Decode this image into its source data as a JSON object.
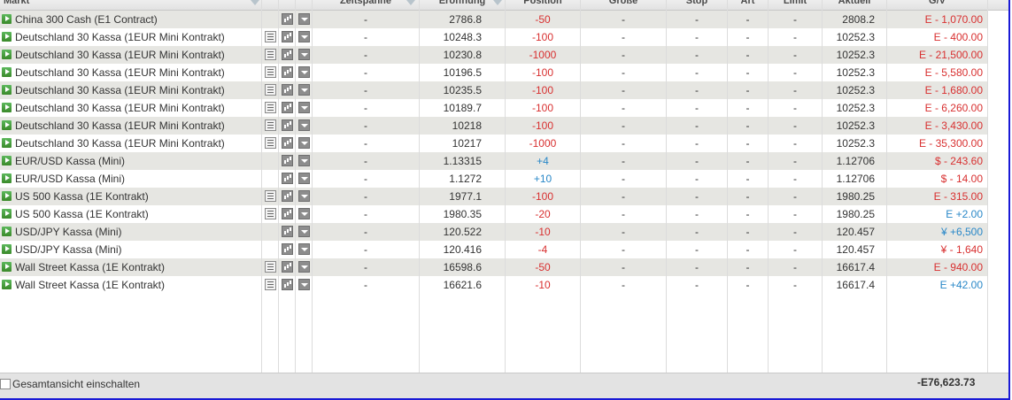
{
  "header": {
    "markt": "Markt",
    "zeitspanne": "Zeitspanne",
    "eroeffnung": "Eröffnung",
    "position": "Position",
    "groesse": "Größe",
    "stop": "Stop",
    "art": "Art",
    "limit": "Limit",
    "aktuell": "Aktuell",
    "gv": "G/V"
  },
  "rows": [
    {
      "name": "China 300 Cash (E1 Contract)",
      "notes": false,
      "zeit": "-",
      "open": "2786.8",
      "pos": "-50",
      "size": "-",
      "stop": "-",
      "art": "-",
      "limit": "-",
      "current": "2808.2",
      "pl": "E - 1,070.00",
      "pl_sign": "neg"
    },
    {
      "name": "Deutschland 30 Kassa (1EUR Mini Kontrakt)",
      "notes": true,
      "zeit": "-",
      "open": "10248.3",
      "pos": "-100",
      "size": "-",
      "stop": "-",
      "art": "-",
      "limit": "-",
      "current": "10252.3",
      "pl": "E - 400.00",
      "pl_sign": "neg"
    },
    {
      "name": "Deutschland 30 Kassa (1EUR Mini Kontrakt)",
      "notes": true,
      "zeit": "-",
      "open": "10230.8",
      "pos": "-1000",
      "size": "-",
      "stop": "-",
      "art": "-",
      "limit": "-",
      "current": "10252.3",
      "pl": "E - 21,500.00",
      "pl_sign": "neg"
    },
    {
      "name": "Deutschland 30 Kassa (1EUR Mini Kontrakt)",
      "notes": true,
      "zeit": "-",
      "open": "10196.5",
      "pos": "-100",
      "size": "-",
      "stop": "-",
      "art": "-",
      "limit": "-",
      "current": "10252.3",
      "pl": "E - 5,580.00",
      "pl_sign": "neg"
    },
    {
      "name": "Deutschland 30 Kassa (1EUR Mini Kontrakt)",
      "notes": true,
      "zeit": "-",
      "open": "10235.5",
      "pos": "-100",
      "size": "-",
      "stop": "-",
      "art": "-",
      "limit": "-",
      "current": "10252.3",
      "pl": "E - 1,680.00",
      "pl_sign": "neg"
    },
    {
      "name": "Deutschland 30 Kassa (1EUR Mini Kontrakt)",
      "notes": true,
      "zeit": "-",
      "open": "10189.7",
      "pos": "-100",
      "size": "-",
      "stop": "-",
      "art": "-",
      "limit": "-",
      "current": "10252.3",
      "pl": "E - 6,260.00",
      "pl_sign": "neg"
    },
    {
      "name": "Deutschland 30 Kassa (1EUR Mini Kontrakt)",
      "notes": true,
      "zeit": "-",
      "open": "10218",
      "pos": "-100",
      "size": "-",
      "stop": "-",
      "art": "-",
      "limit": "-",
      "current": "10252.3",
      "pl": "E - 3,430.00",
      "pl_sign": "neg"
    },
    {
      "name": "Deutschland 30 Kassa (1EUR Mini Kontrakt)",
      "notes": true,
      "zeit": "-",
      "open": "10217",
      "pos": "-1000",
      "size": "-",
      "stop": "-",
      "art": "-",
      "limit": "-",
      "current": "10252.3",
      "pl": "E - 35,300.00",
      "pl_sign": "neg"
    },
    {
      "name": "EUR/USD Kassa (Mini)",
      "notes": false,
      "zeit": "-",
      "open": "1.13315",
      "pos": "+4",
      "size": "-",
      "stop": "-",
      "art": "-",
      "limit": "-",
      "current": "1.12706",
      "pl": "$ - 243.60",
      "pl_sign": "neg"
    },
    {
      "name": "EUR/USD Kassa (Mini)",
      "notes": false,
      "zeit": "-",
      "open": "1.1272",
      "pos": "+10",
      "size": "-",
      "stop": "-",
      "art": "-",
      "limit": "-",
      "current": "1.12706",
      "pl": "$ - 14.00",
      "pl_sign": "neg"
    },
    {
      "name": "US 500 Kassa (1E Kontrakt)",
      "notes": true,
      "zeit": "-",
      "open": "1977.1",
      "pos": "-100",
      "size": "-",
      "stop": "-",
      "art": "-",
      "limit": "-",
      "current": "1980.25",
      "pl": "E - 315.00",
      "pl_sign": "neg"
    },
    {
      "name": "US 500 Kassa (1E Kontrakt)",
      "notes": true,
      "zeit": "-",
      "open": "1980.35",
      "pos": "-20",
      "size": "-",
      "stop": "-",
      "art": "-",
      "limit": "-",
      "current": "1980.25",
      "pl": "E +2.00",
      "pl_sign": "pos"
    },
    {
      "name": "USD/JPY Kassa (Mini)",
      "notes": false,
      "zeit": "-",
      "open": "120.522",
      "pos": "-10",
      "size": "-",
      "stop": "-",
      "art": "-",
      "limit": "-",
      "current": "120.457",
      "pl": "¥ +6,500",
      "pl_sign": "pos"
    },
    {
      "name": "USD/JPY Kassa (Mini)",
      "notes": false,
      "zeit": "-",
      "open": "120.416",
      "pos": "-4",
      "size": "-",
      "stop": "-",
      "art": "-",
      "limit": "-",
      "current": "120.457",
      "pl": "¥ - 1,640",
      "pl_sign": "neg"
    },
    {
      "name": "Wall Street Kassa (1E Kontrakt)",
      "notes": true,
      "zeit": "-",
      "open": "16598.6",
      "pos": "-50",
      "size": "-",
      "stop": "-",
      "art": "-",
      "limit": "-",
      "current": "16617.4",
      "pl": "E - 940.00",
      "pl_sign": "neg"
    },
    {
      "name": "Wall Street Kassa (1E Kontrakt)",
      "notes": true,
      "zeit": "-",
      "open": "16621.6",
      "pos": "-10",
      "size": "-",
      "stop": "-",
      "art": "-",
      "limit": "-",
      "current": "16617.4",
      "pl": "E +42.00",
      "pl_sign": "pos"
    }
  ],
  "footer": {
    "toggle_label": "Gesamtansicht einschalten",
    "total": "-E76,623.73"
  },
  "colors": {
    "negative": "#d83030",
    "positive": "#2a88c8",
    "row_alt": "#e6e6e2",
    "play_button": "#4aa03a",
    "frame_border": "#1a1ad6"
  },
  "icons": {
    "row_open": "play-icon",
    "notes": "notes-icon",
    "chart": "chart-icon",
    "menu": "dropdown-icon"
  }
}
